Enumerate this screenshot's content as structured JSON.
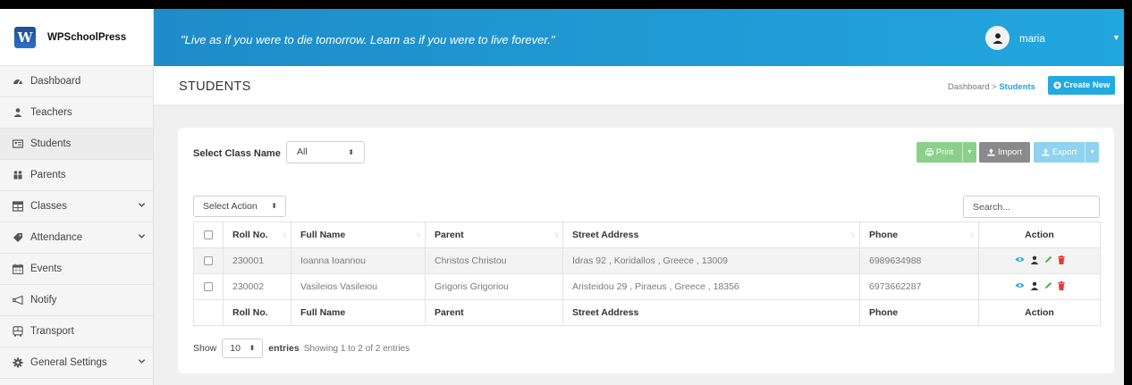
{
  "app": {
    "name": "WPSchoolPress",
    "logo_letter": "W"
  },
  "sidebar": {
    "items": [
      {
        "label": "Dashboard",
        "icon": "dashboard-icon"
      },
      {
        "label": "Teachers",
        "icon": "teacher-icon"
      },
      {
        "label": "Students",
        "icon": "student-card-icon",
        "active": true
      },
      {
        "label": "Parents",
        "icon": "parents-icon"
      },
      {
        "label": "Classes",
        "icon": "table-icon",
        "expandable": true
      },
      {
        "label": "Attendance",
        "icon": "tag-icon",
        "expandable": true
      },
      {
        "label": "Events",
        "icon": "calendar-icon"
      },
      {
        "label": "Notify",
        "icon": "megaphone-icon"
      },
      {
        "label": "Transport",
        "icon": "bus-icon"
      },
      {
        "label": "General Settings",
        "icon": "gear-icon",
        "expandable": true
      }
    ]
  },
  "header": {
    "quote": "\"Live as if you were to die tomorrow. Learn as if you were to live forever.\"",
    "username": "maria"
  },
  "page": {
    "title": "STUDENTS",
    "breadcrumb_parent": "Dashboard",
    "breadcrumb_separator": ">",
    "breadcrumb_current": "Students",
    "create_label": "Create New"
  },
  "filters": {
    "class_label": "Select Class Name",
    "class_value": "All",
    "action_value": "Select Action",
    "search_placeholder": "Search..."
  },
  "toolbar": {
    "print": "Print",
    "import": "Import",
    "export": "Export"
  },
  "table": {
    "headers": [
      "Roll No.",
      "Full Name",
      "Parent",
      "Street Address",
      "Phone",
      "Action"
    ],
    "rows": [
      [
        "230001",
        "Ioanna Ioannou",
        "Christos Christou",
        "Idras 92 , Koridallos , Greece , 13009",
        "6989634988"
      ],
      [
        "230002",
        "Vasileios Vasileiou",
        "Grigoris Grigoriou",
        "Aristeidou 29 , Piraeus , Greece , 18356",
        "6973662287"
      ]
    ],
    "row_actions": [
      "view-icon",
      "user-icon",
      "edit-icon",
      "delete-icon"
    ]
  },
  "footer": {
    "show": "Show",
    "page_length": "10",
    "entries": "entries",
    "info": "Showing 1 to 2 of 2 entries"
  },
  "colors": {
    "header_gradient_start": "#1e8cc8",
    "header_gradient_end": "#22a6de",
    "accent": "#24a9e0",
    "print_button": "#8ad08a",
    "import_button": "#8a8a8a",
    "export_button": "#8fd3f0",
    "edit_icon": "#4caf50",
    "delete_icon": "#e53935"
  }
}
